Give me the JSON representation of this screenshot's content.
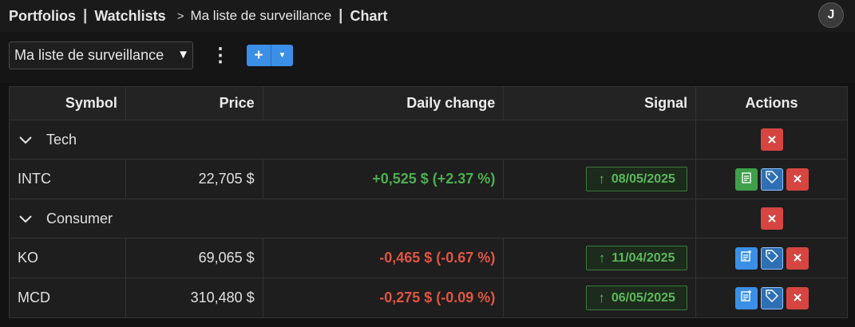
{
  "breadcrumbs": {
    "portfolios": "Portfolios",
    "sep1": "|",
    "watchlists": "Watchlists",
    "arrow": ">",
    "watchlist_name": "Ma liste de surveillance",
    "sep2": "|",
    "chart": "Chart"
  },
  "user": {
    "avatar_initial": "J"
  },
  "toolbar": {
    "selected_watchlist": "Ma liste de surveillance",
    "caret": "▼",
    "menu_glyph": "⋮",
    "add_label": "+",
    "add_dropdown_glyph": "▼"
  },
  "table": {
    "headers": {
      "symbol": "Symbol",
      "price": "Price",
      "daily_change": "Daily change",
      "signal": "Signal",
      "actions": "Actions"
    },
    "groups": [
      {
        "name": "Tech",
        "rows": [
          {
            "symbol": "INTC",
            "price": "22,705 $",
            "change": "+0,525 $ (+2.37 %)",
            "direction": "up",
            "signal_arrow": "↑",
            "signal_date": "08/05/2025",
            "note_icon": "document-icon"
          }
        ]
      },
      {
        "name": "Consumer",
        "rows": [
          {
            "symbol": "KO",
            "price": "69,065 $",
            "change": "-0,465 $ (-0.67 %)",
            "direction": "down",
            "signal_arrow": "↑",
            "signal_date": "11/04/2025",
            "note_icon": "add-note-icon"
          },
          {
            "symbol": "MCD",
            "price": "310,480 $",
            "change": "-0,275 $ (-0.09 %)",
            "direction": "down",
            "signal_arrow": "↑",
            "signal_date": "06/05/2025",
            "note_icon": "add-note-icon"
          }
        ]
      }
    ]
  },
  "colors": {
    "positive": "#4caf50",
    "negative": "#e05543",
    "accent_blue": "#3b8fe6",
    "danger_red": "#d64540",
    "success_green": "#3f9f4a"
  }
}
